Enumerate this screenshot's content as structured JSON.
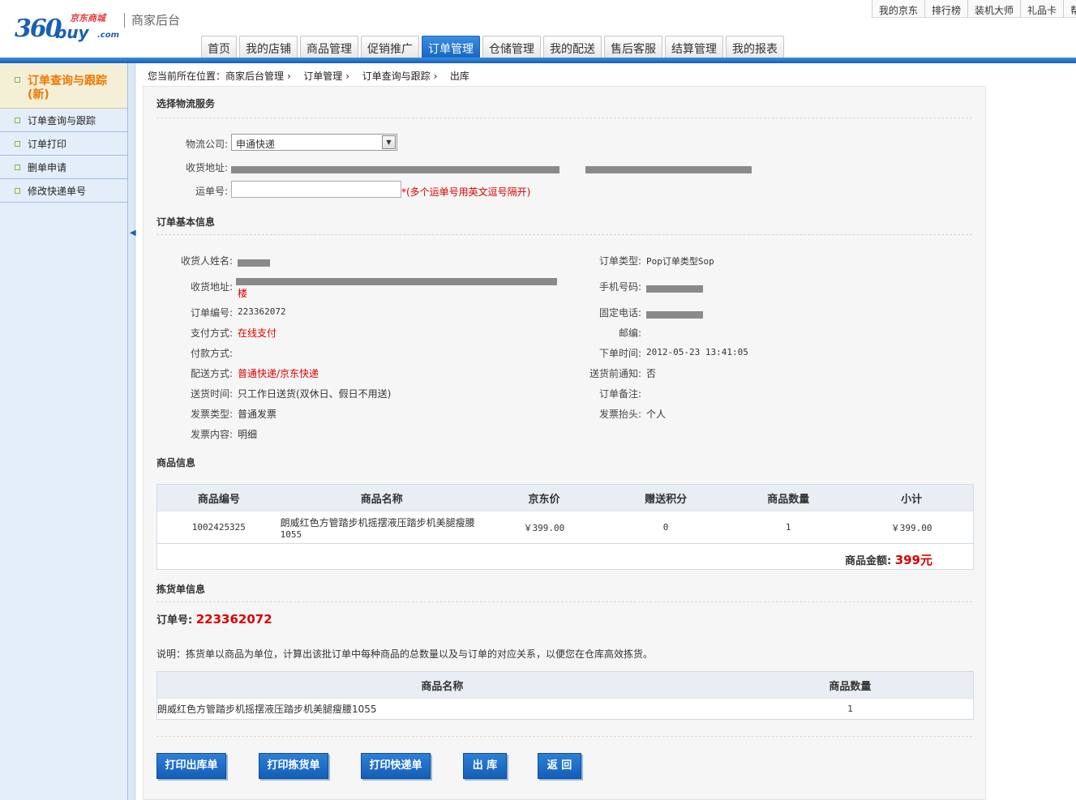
{
  "header": {
    "logo_num": "360",
    "logo_buy": "buy",
    "logo_jd": "京东商城",
    "logo_com": ".com",
    "system_title": "商家后台",
    "top_links": [
      "我的京东",
      "排行榜",
      "装机大师",
      "礼品卡",
      "帮"
    ]
  },
  "nav": {
    "tabs": [
      "首页",
      "我的店铺",
      "商品管理",
      "促销推广",
      "订单管理",
      "仓储管理",
      "我的配送",
      "售后客服",
      "结算管理",
      "我的报表"
    ],
    "active_index": 4
  },
  "sidebar": {
    "header": "订单查询与跟踪(新)",
    "items": [
      "订单查询与跟踪",
      "订单打印",
      "删单申请",
      "修改快递单号"
    ]
  },
  "breadcrumb": [
    "您当前所在位置：商家后台管理",
    "订单管理",
    "订单查询与跟踪",
    "出库"
  ],
  "logistics": {
    "title": "选择物流服务",
    "company_label": "物流公司:",
    "company_value": "申通快递",
    "address_label": "收货地址:",
    "tracking_label": "运单号:",
    "tracking_hint": "*(多个运单号用英文逗号隔开)"
  },
  "order_info": {
    "title": "订单基本信息",
    "name_label": "收货人姓名:",
    "address_label": "收货地址:",
    "address_tail": "楼",
    "order_no_label": "订单编号:",
    "order_no": "223362072",
    "pay_label": "支付方式:",
    "pay_value": "在线支付",
    "payment_label": "付款方式:",
    "ship_label": "配送方式:",
    "ship_value": "普通快递/京东快递",
    "time_label": "送货时间:",
    "time_value": "只工作日送货(双休日、假日不用送)",
    "invoice_type_label": "发票类型:",
    "invoice_type_value": "普通发票",
    "invoice_content_label": "发票内容:",
    "invoice_content_value": "明细",
    "order_type_label": "订单类型:",
    "order_type_value": "Pop订单类型Sop",
    "mobile_label": "手机号码:",
    "phone_label": "固定电话:",
    "zip_label": "邮编:",
    "order_time_label": "下单时间:",
    "order_time_value": "2012-05-23 13:41:05",
    "notify_label": "送货前通知:",
    "notify_value": "否",
    "remark_label": "订单备注:",
    "invoice_title_label": "发票抬头:",
    "invoice_title_value": "个人"
  },
  "products": {
    "title": "商品信息",
    "columns": [
      "商品编号",
      "商品名称",
      "京东价",
      "赠送积分",
      "商品数量",
      "小计"
    ],
    "rows": [
      {
        "id": "1002425325",
        "name_line1": "朗威红色方管踏步机摇摆液压踏步机美腿瘦腰",
        "name_line2": "1055",
        "price": "￥399.00",
        "points": "0",
        "qty": "1",
        "subtotal": "￥399.00"
      }
    ],
    "total_label": "商品金额:",
    "total_value": "399元"
  },
  "picking": {
    "title": "拣货单信息",
    "order_label": "订单号:",
    "order_value": "223362072",
    "note": "说明：拣货单以商品为单位，计算出该批订单中每种商品的总数量以及与订单的对应关系，以便您在仓库高效拣货。",
    "columns": [
      "商品名称",
      "商品数量"
    ],
    "rows": [
      {
        "name": "朗威红色方管踏步机摇摆液压踏步机美腿瘦腰1055",
        "qty": "1"
      }
    ]
  },
  "buttons": {
    "print_out": "打印出库单",
    "print_pick": "打印拣货单",
    "print_express": "打印快递单",
    "ship_out": "出 库",
    "back": "返 回"
  }
}
